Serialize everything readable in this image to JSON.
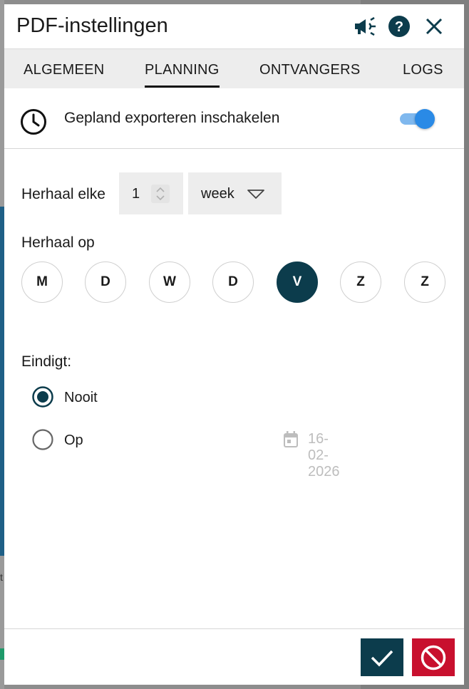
{
  "dialog": {
    "title": "PDF-instellingen",
    "icons": [
      "megaphone-icon",
      "help-icon",
      "close-icon"
    ]
  },
  "tabs": [
    {
      "label": "ALGEMEEN",
      "active": false
    },
    {
      "label": "PLANNING",
      "active": true
    },
    {
      "label": "ONTVANGERS",
      "active": false
    },
    {
      "label": "LOGS",
      "active": false
    }
  ],
  "schedule": {
    "toggle_label": "Gepland exporteren inschakelen",
    "toggle_on": true,
    "repeat_every_label": "Herhaal elke",
    "repeat_every_value": "1",
    "repeat_unit": "week",
    "repeat_on_label": "Herhaal op",
    "days": [
      {
        "label": "M",
        "selected": false
      },
      {
        "label": "D",
        "selected": false
      },
      {
        "label": "W",
        "selected": false
      },
      {
        "label": "D",
        "selected": false
      },
      {
        "label": "V",
        "selected": true
      },
      {
        "label": "Z",
        "selected": false
      },
      {
        "label": "Z",
        "selected": false
      }
    ],
    "ends_label": "Eindigt:",
    "ends_options": [
      {
        "label": "Nooit",
        "selected": true
      },
      {
        "label": "Op",
        "selected": false
      }
    ],
    "end_date": "16-02-2026"
  },
  "colors": {
    "accent": "#0c3c4c",
    "toggle": "#2a8ae6",
    "cancel": "#c8102e"
  }
}
